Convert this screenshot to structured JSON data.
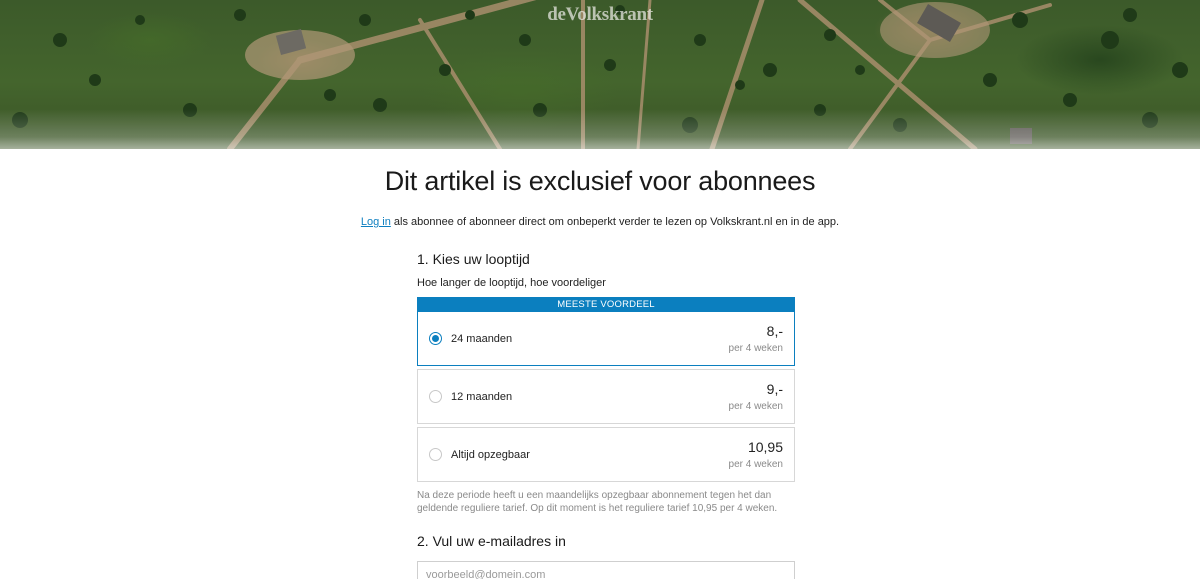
{
  "header": {
    "logo_text": "deVolkskrant"
  },
  "page": {
    "title": "Dit artikel is exclusief voor abonnees",
    "intro_link": "Log in",
    "intro_rest": " als abonnee of abonneer direct om onbeperkt verder te lezen op Volkskrant.nl en in de app."
  },
  "step1": {
    "heading": "1. Kies uw looptijd",
    "subline": "Hoe langer de looptijd, hoe voordeliger",
    "badge": "MEESTE VOORDEEL",
    "options": [
      {
        "label": "24 maanden",
        "price": "8,-",
        "per": "per 4 weken",
        "selected": true
      },
      {
        "label": "12 maanden",
        "price": "9,-",
        "per": "per 4 weken",
        "selected": false
      },
      {
        "label": "Altijd opzegbaar",
        "price": "10,95",
        "per": "per 4 weken",
        "selected": false
      }
    ],
    "note": "Na deze periode heeft u een maandelijks opzegbaar abonnement tegen het dan geldende reguliere tarief. Op dit moment is het reguliere tarief 10,95 per 4 weken."
  },
  "step2": {
    "heading": "2. Vul uw e-mailadres in",
    "email_placeholder": "voorbeeld@domein.com"
  },
  "colors": {
    "accent": "#0b7fbf",
    "link": "#0e7fc0",
    "muted_text": "#8a8a8a",
    "border": "#d7d7d7"
  }
}
